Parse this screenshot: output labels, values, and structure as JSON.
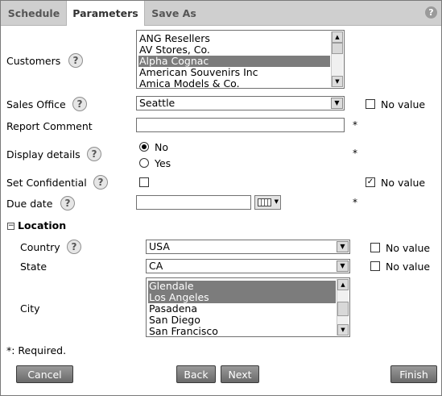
{
  "tabs": [
    {
      "label": "Schedule"
    },
    {
      "label": "Parameters"
    },
    {
      "label": "Save As"
    }
  ],
  "help_glyph": "?",
  "customers": {
    "label": "Customers",
    "options": [
      "ANG Resellers",
      "AV Stores, Co.",
      "Alpha Cognac",
      "American Souvenirs Inc",
      "Amica Models & Co."
    ],
    "selected": "Alpha Cognac"
  },
  "sales_office": {
    "label": "Sales Office",
    "value": "Seattle",
    "no_value_label": "No value",
    "no_value_checked": false
  },
  "report_comment": {
    "label": "Report Comment",
    "value": "",
    "required": "*"
  },
  "display_details": {
    "label": "Display details",
    "options": [
      "No",
      "Yes"
    ],
    "selected": "No",
    "required": "*"
  },
  "set_confidential": {
    "label": "Set Confidential",
    "checked": false,
    "no_value_label": "No value",
    "no_value_checked": true
  },
  "due_date": {
    "label": "Due date",
    "value": "",
    "required": "*"
  },
  "location": {
    "label": "Location",
    "country": {
      "label": "Country",
      "value": "USA",
      "no_value_label": "No value",
      "no_value_checked": false
    },
    "state": {
      "label": "State",
      "value": "CA",
      "no_value_label": "No value",
      "no_value_checked": false
    },
    "city": {
      "label": "City",
      "options": [
        "Glendale",
        "Los Angeles",
        "Pasadena",
        "San Diego",
        "San Francisco"
      ],
      "selected": [
        "Glendale",
        "Los Angeles"
      ]
    }
  },
  "required_note": "*: Required.",
  "buttons": {
    "cancel": "Cancel",
    "back": "Back",
    "next": "Next",
    "finish": "Finish"
  }
}
